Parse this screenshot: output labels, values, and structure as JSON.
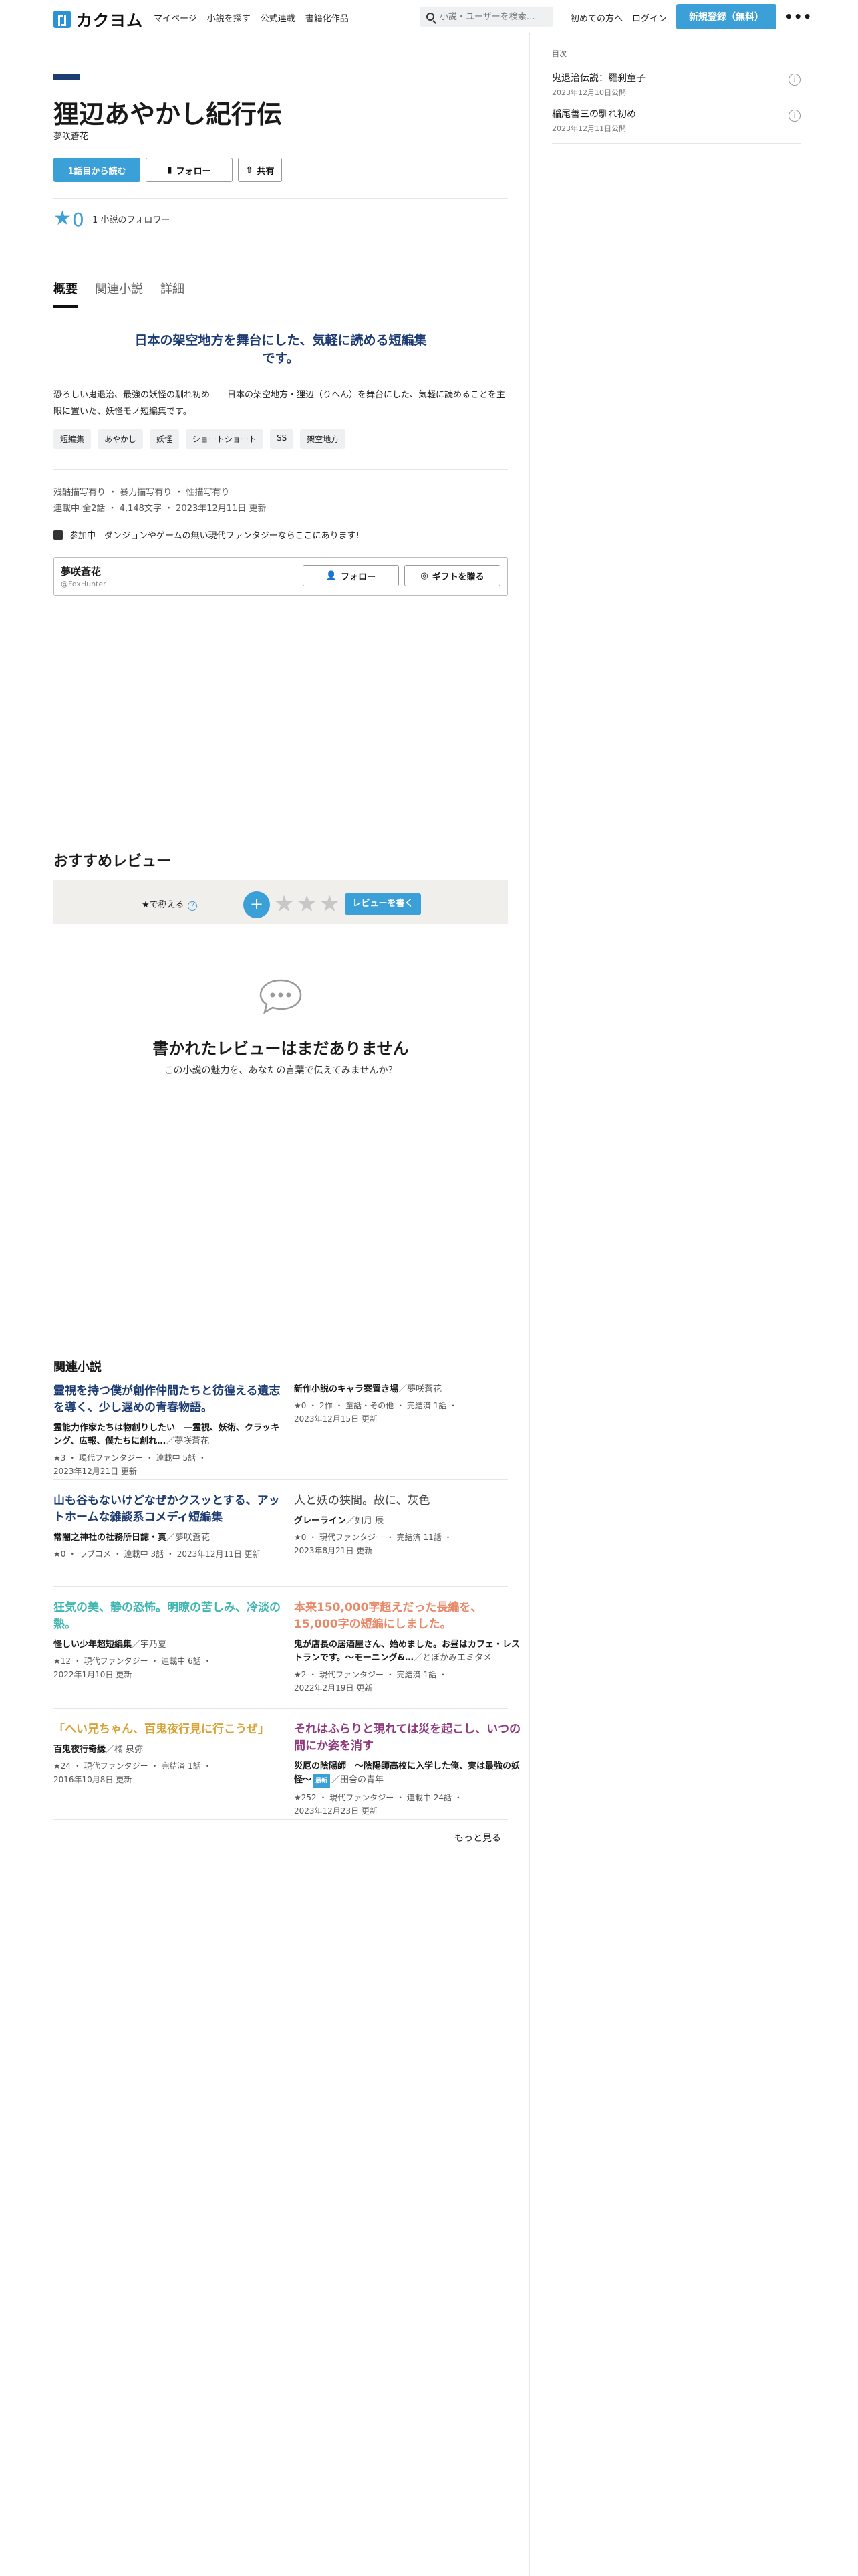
{
  "header": {
    "logo_text": "カクヨム",
    "nav": [
      "マイページ",
      "小説を探す",
      "公式連載",
      "書籍化作品"
    ],
    "search_placeholder": "小説・ユーザーを検索…",
    "first_time": "初めての方へ",
    "login": "ログイン",
    "signup": "新規登録（無料）",
    "more": "•••"
  },
  "sidebar": {
    "heading": "目次",
    "items": [
      {
        "title": "鬼退治伝説：羅刹童子",
        "date": "2023年12月10日公開"
      },
      {
        "title": "稲尾善三の馴れ初め",
        "date": "2023年12月11日公開"
      }
    ]
  },
  "work": {
    "title": "狸辺あやかし紀行伝",
    "author": "夢咲蒼花",
    "read_button": "1話目から読む",
    "follow_button": "フォロー",
    "share_button": "共有",
    "star_count": "0",
    "followers": "1 小説のフォロワー",
    "tabs": [
      "概要",
      "関連小説",
      "詳細"
    ],
    "catchphrase": "日本の架空地方を舞台にした、気軽に読める短編集です。",
    "introduction": "恐ろしい鬼退治、最強の妖怪の馴れ初め――日本の架空地方・狸辺（りへん）を舞台にした、気軽に読めることを主眼に置いた、妖怪モノ短編集です。",
    "tags": [
      "短編集",
      "あやかし",
      "妖怪",
      "ショートショート",
      "SS",
      "架空地方"
    ],
    "ratings": "残酷描写有り ・ 暴力描写有り ・ 性描写有り",
    "stats": "連載中 全2話 ・ 4,148文字 ・ 2023年12月11日 更新",
    "event": "参加中　ダンジョンやゲームの無い現代ファンタジーならここにあります!",
    "author_card": {
      "name": "夢咲蒼花",
      "id": "@FoxHunter",
      "follow": "フォロー",
      "gift": "ギフトを贈る"
    }
  },
  "reviews": {
    "heading": "おすすめレビュー",
    "rate_label": "★で称える",
    "write_button": "レビューを書く",
    "empty_title": "書かれたレビューはまだありません",
    "empty_sub": "この小説の魅力を、あなたの言葉で伝えてみませんか？",
    "colors": {
      "star_empty": "#c7c7c7",
      "accent": "#3b9fd8",
      "bar_bg": "#f1efec"
    }
  },
  "related": {
    "heading": "関連小説",
    "more": "もっと見る",
    "items": [
      {
        "catch": "霊視を持つ僕が創作仲間たちと彷徨える遺志を導く、少し遅めの青春物語。",
        "title": "霊能力作家たちは物創りしたい　―霊視、妖術、クラッキング、広報、僕たちに創れ…",
        "by": "／夢咲蒼花",
        "meta": "★3 ・ 現代ファンタジー ・ 連載中 5話 ・",
        "date": "2023年12月21日 更新",
        "color": "#1d3c74"
      },
      {
        "catch": "",
        "title": "新作小説のキャラ案置き場",
        "by": "／夢咲蒼花",
        "meta": "★0 ・ 2作 ・ 童話・その他 ・ 完結済 1話 ・",
        "date": "2023年12月15日 更新",
        "color": "#1a1a1a"
      },
      {
        "catch": "山も谷もないけどなぜかクスッとする、アットホームな雑談系コメディ短編集",
        "title": "常闇之神社の社務所日誌・真",
        "by": "／夢咲蒼花",
        "meta": "★0 ・ ラブコメ ・ 連載中 3話 ・ 2023年12月11日 更新",
        "date": "",
        "color": "#1d3c74"
      },
      {
        "catch": "人と妖の狭間。故に、灰色",
        "title": "グレーライン",
        "by": "／如月 辰",
        "meta": "★0 ・ 現代ファンタジー ・ 完結済 11話 ・",
        "date": "2023年8月21日 更新",
        "color": "#444444"
      },
      {
        "catch": "狂気の美、静の恐怖。明瞭の苦しみ、冷淡の熱。",
        "title": "怪しい少年超短編集",
        "by": "／宇乃夏",
        "meta": "★12 ・ 現代ファンタジー ・ 連載中 6話 ・",
        "date": "2022年1月10日 更新",
        "color": "#3fb7b0"
      },
      {
        "catch": "本来150,000字超えだった長編を、15,000字の短編にしました。",
        "title": "鬼が店長の居酒屋さん、始めました。お昼はカフェ・レストランです。〜モーニング&…",
        "by": "／とぼかみエミタメ",
        "meta": "★2 ・ 現代ファンタジー ・ 完結済 1話 ・",
        "date": "2022年2月19日 更新",
        "color": "#e88a6a"
      },
      {
        "catch": "「へい兄ちゃん、百鬼夜行見に行こうぜ」",
        "title": "百鬼夜行奇縁",
        "by": "／橘 泉弥",
        "meta": "★24 ・ 現代ファンタジー ・ 完結済 1話 ・",
        "date": "2016年10月8日 更新",
        "color": "#d8a233"
      },
      {
        "catch": "それはふらりと現れては災を起こし、いつの間にか姿を消す",
        "title": "災厄の陰陽師　〜陰陽師高校に入学した俺、実は最強の妖怪〜",
        "by": "／田舎の青年",
        "badge": "最新",
        "meta": "★252 ・ 現代ファンタジー ・ 連載中 24話 ・",
        "date": "2023年12月23日 更新",
        "color": "#8e3a7d"
      }
    ]
  }
}
